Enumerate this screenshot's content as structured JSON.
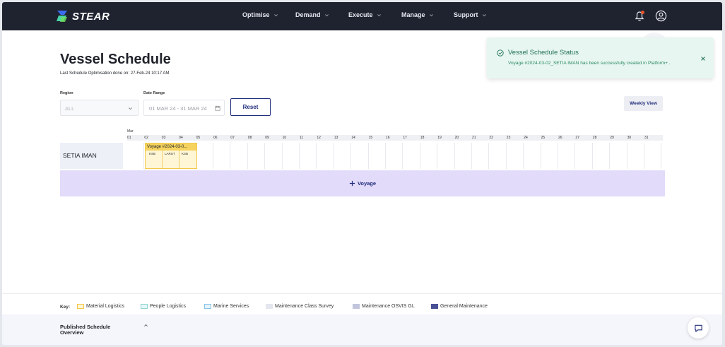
{
  "nav": {
    "brand": "STEAR",
    "items": [
      {
        "label": "Optimise"
      },
      {
        "label": "Demand"
      },
      {
        "label": "Execute"
      },
      {
        "label": "Manage"
      },
      {
        "label": "Support"
      }
    ]
  },
  "page": {
    "title": "Vessel Schedule",
    "last_optimisation": "Last Schedule Optimisation done on: 27-Feb-24 10:17 AM"
  },
  "filters": {
    "region_label": "Region",
    "region_value": "ALL",
    "date_label": "Date Range",
    "date_value": "01 MAR 24 - 31 MAR 24",
    "reset_label": "Reset",
    "weekly_view_label": "Weekly View"
  },
  "timeline": {
    "month": "Mar",
    "days": [
      "01",
      "02",
      "03",
      "04",
      "05",
      "06",
      "07",
      "08",
      "09",
      "10",
      "11",
      "12",
      "13",
      "14",
      "15",
      "16",
      "17",
      "18",
      "19",
      "20",
      "21",
      "22",
      "23",
      "24",
      "25",
      "26",
      "27",
      "28",
      "29",
      "30",
      "31"
    ],
    "vessels": [
      {
        "name": "SETIA IMAN",
        "voyages": [
          {
            "title": "Voyage #2024-03-0...",
            "ports": [
              "KSB",
              "LARUT",
              "KSB"
            ],
            "category": "Material Logistics"
          }
        ]
      }
    ],
    "add_voyage_label": "Voyage"
  },
  "legend": {
    "key_label": "Key:",
    "items": [
      {
        "label": "Material Logistics",
        "color": "#fff6d6",
        "border": "#f3c84b"
      },
      {
        "label": "People Logistics",
        "color": "#e6f7f7",
        "border": "#8fd3d3"
      },
      {
        "label": "Marine Services",
        "color": "#e6f3fb",
        "border": "#86c3e6"
      },
      {
        "label": "Maintenance Class Survey",
        "color": "#e4e7ee",
        "border": "#e4e7ee"
      },
      {
        "label": "Maintenance OSVIS GL",
        "color": "#c2c5dc",
        "border": "#c2c5dc"
      },
      {
        "label": "General Maintenance",
        "color": "#4a5296",
        "border": "#4a5296"
      }
    ]
  },
  "published": {
    "title": "Published Schedule Overview"
  },
  "toast": {
    "title": "Vessel Schedule Status",
    "message": "Voyage #2024-03-02_SETIA IMAN has been successfully created in Platform+ ."
  },
  "colors": {
    "navbar": "#1f2330",
    "primary": "#1f2b7a",
    "add_voyage_bg": "#e3dbfa",
    "toast_bg": "#e7f6f1",
    "toast_text": "#1e6f52"
  }
}
